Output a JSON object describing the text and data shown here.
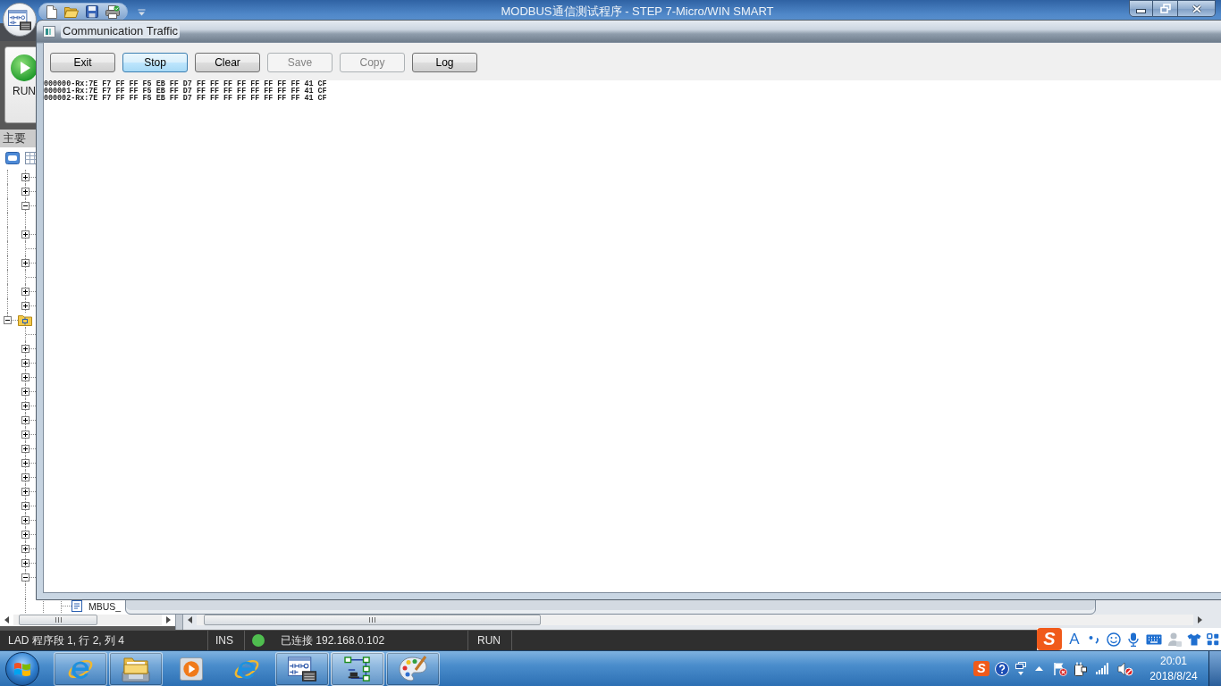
{
  "app_window": {
    "title": "MODBUS通信测试程序 - STEP 7-Micro/WIN SMART",
    "ribbon": {
      "run_button": "RUN"
    },
    "project_tree": {
      "header": "主要",
      "continued_items": [
        {
          "kind": "branch",
          "expanded": false
        },
        {
          "kind": "branch",
          "expanded": false
        },
        {
          "kind": "branch",
          "expanded": true,
          "children": [
            {
              "kind": "leaf"
            }
          ]
        },
        {
          "kind": "branch",
          "expanded": false
        },
        {
          "kind": "leaf"
        },
        {
          "kind": "branch",
          "expanded": false
        },
        {
          "kind": "leaf"
        },
        {
          "kind": "branch",
          "expanded": false
        },
        {
          "kind": "branch",
          "expanded": false
        }
      ],
      "nodes": [
        {
          "kind": "folder",
          "expanded": true,
          "children": [
            {
              "kind": "leaf"
            },
            {
              "kind": "branch",
              "expanded": false
            },
            {
              "kind": "branch",
              "expanded": false
            },
            {
              "kind": "branch",
              "expanded": false
            },
            {
              "kind": "branch",
              "expanded": false
            },
            {
              "kind": "branch",
              "expanded": false
            },
            {
              "kind": "branch",
              "expanded": false
            },
            {
              "kind": "branch",
              "expanded": false
            },
            {
              "kind": "branch",
              "expanded": false
            },
            {
              "kind": "branch",
              "expanded": false
            },
            {
              "kind": "branch",
              "expanded": false
            },
            {
              "kind": "branch",
              "expanded": false
            },
            {
              "kind": "branch",
              "expanded": false
            },
            {
              "kind": "branch",
              "expanded": false
            },
            {
              "kind": "branch",
              "expanded": false
            },
            {
              "kind": "branch",
              "expanded": false
            },
            {
              "kind": "branch",
              "expanded": false
            },
            {
              "kind": "branch",
              "expanded": true,
              "children": [
                {
                  "kind": "branch",
                  "children": [
                    {
                      "kind": "block",
                      "label": "MBUS_"
                    }
                  ]
                }
              ]
            }
          ]
        }
      ]
    },
    "status_bar": {
      "position": "LAD 程序段 1, 行 2, 列 4",
      "edit_mode": "INS",
      "connection": {
        "color": "#4fbe4f",
        "text": "已连接 192.168.0.102"
      },
      "cpu_state": "RUN"
    }
  },
  "dialog": {
    "title": "Communication Traffic",
    "buttons": [
      {
        "label": "Exit",
        "disabled": false,
        "focused": false
      },
      {
        "label": "Stop",
        "disabled": false,
        "focused": true
      },
      {
        "label": "Clear",
        "disabled": false,
        "focused": false
      },
      {
        "label": "Save",
        "disabled": true,
        "focused": false
      },
      {
        "label": "Copy",
        "disabled": true,
        "focused": false
      },
      {
        "label": "Log",
        "disabled": false,
        "focused": false
      }
    ],
    "log_lines": [
      "000000-Rx:7E F7 FF FF F5 EB FF D7 FF FF FF FF FF FF FF FF 41 CF",
      "000001-Rx:7E F7 FF FF F5 EB FF D7 FF FF FF FF FF FF FF FF 41 CF",
      "000002-Rx:7E F7 FF FF F5 EB FF D7 FF FF FF FF FF FF FF FF 41 CF"
    ]
  },
  "ime_toolbar": {
    "logo": "S",
    "mode": "A"
  },
  "taskbar": {
    "apps": [
      {
        "kind": "browser",
        "running": true,
        "active": false
      },
      {
        "kind": "folder",
        "running": true,
        "active": false
      },
      {
        "kind": "media",
        "running": false,
        "active": false
      },
      {
        "kind": "browser",
        "running": false,
        "active": false
      },
      {
        "kind": "ladder",
        "running": true,
        "active": false
      },
      {
        "kind": "network",
        "running": true,
        "active": true
      },
      {
        "kind": "palette",
        "running": true,
        "active": false
      }
    ],
    "tray": {
      "ime_logo": "S",
      "time": "20:01",
      "date": "2018/8/24"
    }
  }
}
